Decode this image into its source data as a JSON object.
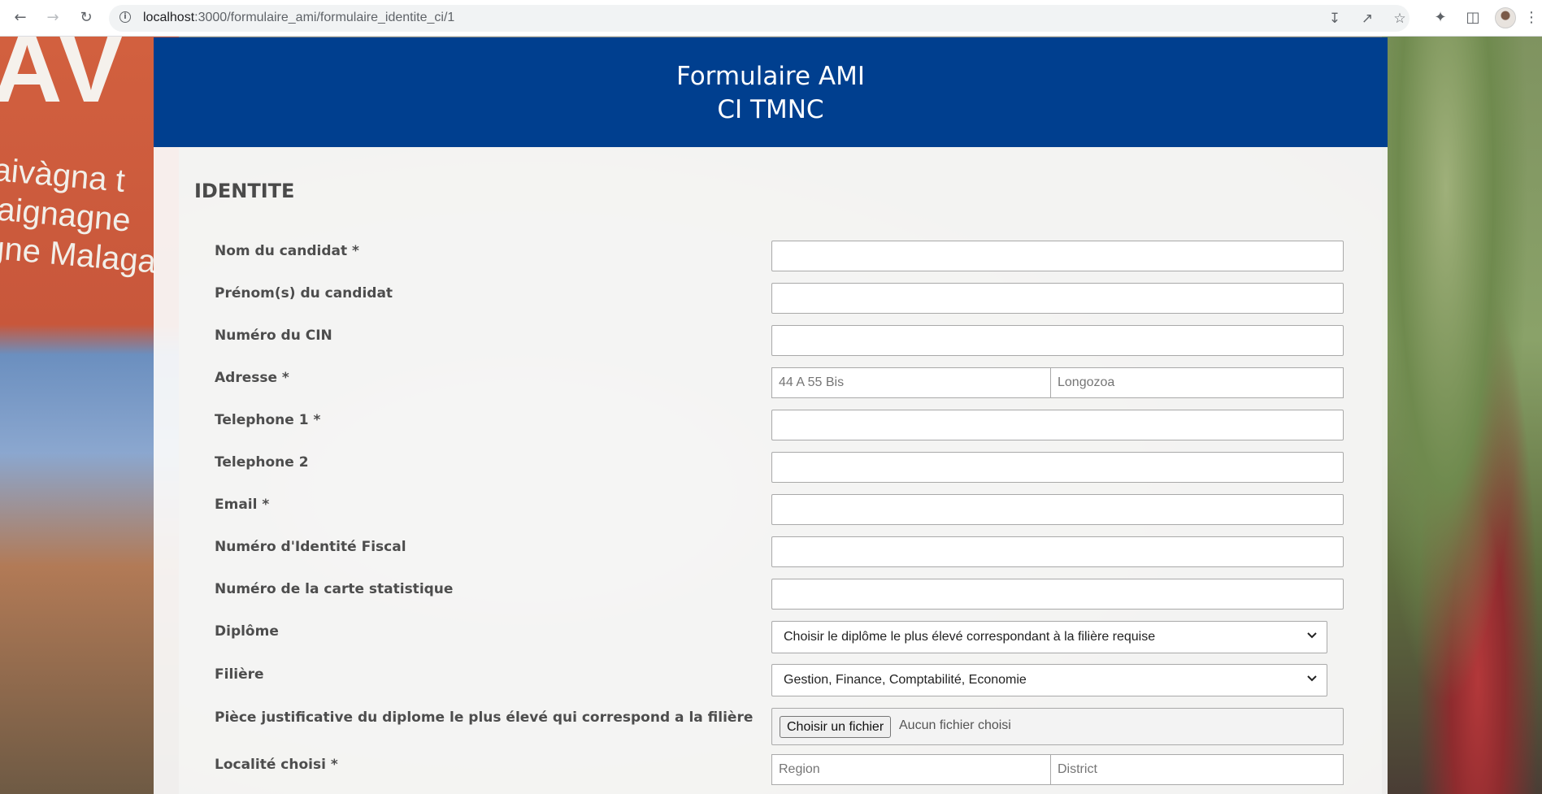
{
  "browser": {
    "url_host": "localhost",
    "url_path": ":3000/formulaire_ami/formulaire_identite_ci/1"
  },
  "header": {
    "title_line1": "Formulaire AMI",
    "title_line2": "CI TMNC"
  },
  "background": {
    "banner_letters": "AV",
    "banner_slogan_line1": "aivàgna t",
    "banner_slogan_line2": "iaignagne",
    "banner_slogan_line3": "gne Malaga"
  },
  "section": {
    "title": "IDENTITE"
  },
  "form": {
    "nom_label": "Nom du candidat *",
    "nom_value": "",
    "prenom_label": "Prénom(s) du candidat",
    "prenom_value": "",
    "cin_label": "Numéro du CIN",
    "cin_value": "",
    "adresse_label": "Adresse *",
    "adresse_placeholder_1": "44 A 55 Bis",
    "adresse_placeholder_2": "Longozoa",
    "tel1_label": "Telephone 1 *",
    "tel1_value": "",
    "tel2_label": "Telephone 2",
    "tel2_value": "",
    "email_label": "Email *",
    "email_value": "",
    "nif_label": "Numéro d'Identité Fiscal",
    "nif_value": "",
    "stat_label": "Numéro de la carte statistique",
    "stat_value": "",
    "diplome_label": "Diplôme",
    "diplome_selected": "Choisir le diplôme le plus élevé correspondant à la filière requise",
    "filiere_label": "Filière",
    "filiere_selected": "Gestion, Finance, Comptabilité, Economie",
    "piece_label": "Pièce justificative du diplome le plus élevé qui correspond a la filière",
    "file_button": "Choisir un fichier",
    "file_status": "Aucun fichier choisi",
    "localite_label": "Localité choisi *",
    "localite_placeholder_1": "Region",
    "localite_placeholder_2": "District"
  }
}
